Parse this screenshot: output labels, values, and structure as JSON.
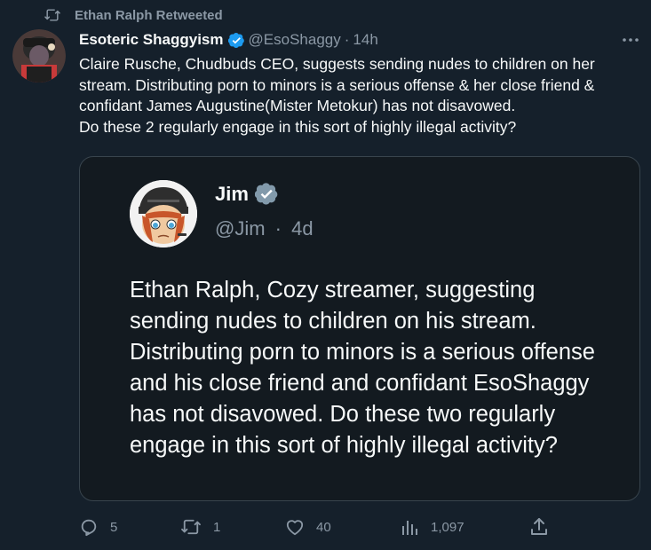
{
  "retweet": {
    "label": "Ethan Ralph Retweeted",
    "icon": "retweet-icon"
  },
  "tweet": {
    "display_name": "Esoteric Shaggyism",
    "handle": "@EsoShaggy",
    "separator": "·",
    "time": "14h",
    "text": "Claire Rusche, Chudbuds CEO, suggests sending nudes to children on her stream. Distributing porn to minors is a serious offense & her close friend & confidant James Augustine(Mister Metokur) has not disavowed.\nDo these 2 regularly engage in this sort of highly illegal activity?",
    "verified_color": "#1d9bf0"
  },
  "quote": {
    "display_name": "Jim",
    "handle": "@Jim",
    "separator": "·",
    "time": "4d",
    "verified_color": "#829aab",
    "text": "Ethan Ralph, Cozy streamer, suggesting sending nudes to children on his stream. Distributing porn to minors is a serious offense and his close friend and confidant EsoShaggy has not disavowed. Do these two regularly engage in this sort of highly illegal activity?"
  },
  "actions": {
    "replies": "5",
    "retweets": "1",
    "likes": "40",
    "views": "1,097",
    "icons": [
      "reply-icon",
      "retweet-icon",
      "like-icon",
      "views-icon",
      "share-icon"
    ]
  },
  "colors": {
    "background": "#15202b",
    "muted_text": "#8b98a5",
    "quote_border": "#38444d"
  }
}
